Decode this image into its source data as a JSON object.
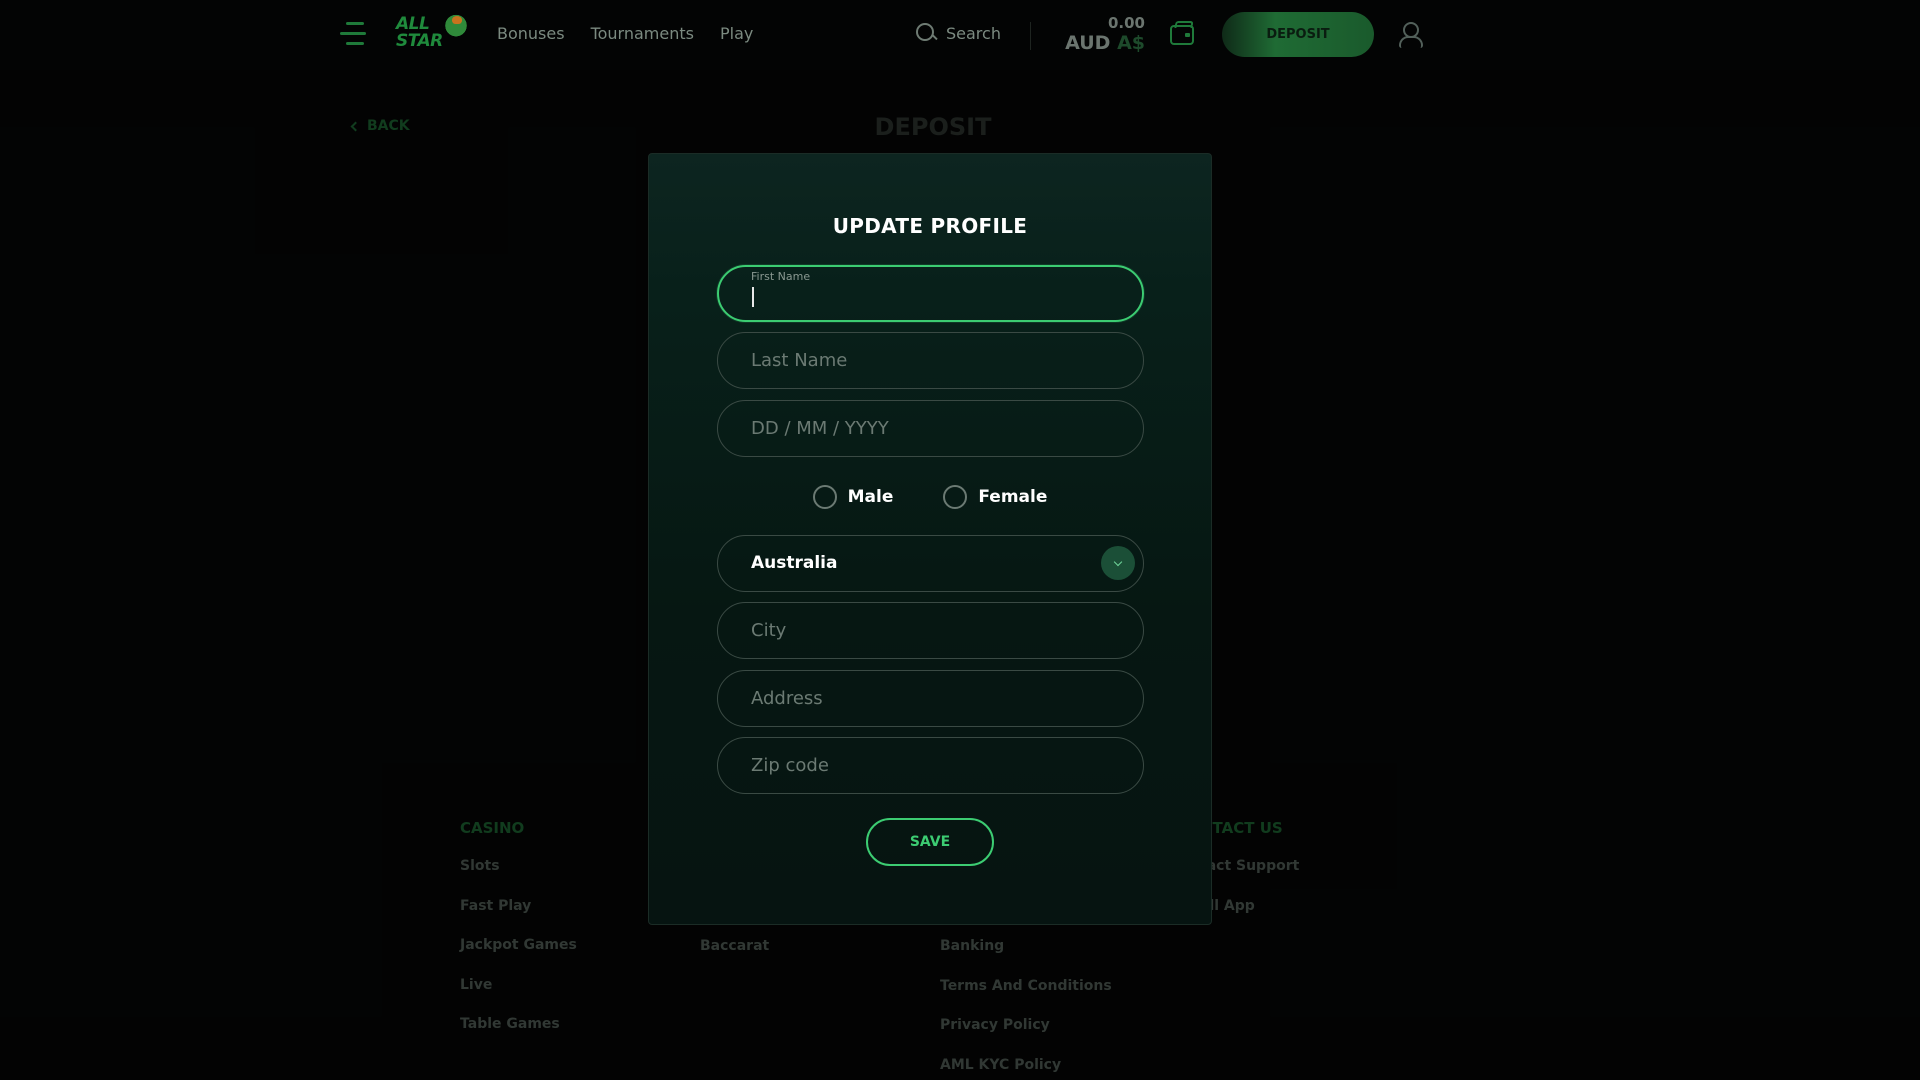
{
  "header": {
    "nav": [
      "Bonuses",
      "Tournaments",
      "Play"
    ],
    "search_label": "Search",
    "balance_amount": "0.00",
    "balance_currency": "AUD",
    "balance_symbol": "A$",
    "deposit_label": "DEPOSIT",
    "logo_text_line1": "ALL",
    "logo_text_line2": "STAR"
  },
  "page": {
    "back_label": "BACK",
    "title": "DEPOSIT"
  },
  "footer": {
    "casino_heading": "CASINO",
    "casino_items": [
      "Slots",
      "Fast Play",
      "Jackpot Games",
      "Live",
      "Table Games"
    ],
    "col2_items": [
      "Baccarat"
    ],
    "col3_items": [
      "Banking",
      "Terms And Conditions",
      "Privacy Policy",
      "AML KYC Policy"
    ],
    "contact_heading": "NTACT US",
    "contact_items": [
      "tact Support",
      "all App"
    ]
  },
  "modal": {
    "title": "UPDATE PROFILE",
    "first_name_label": "First Name",
    "last_name_placeholder": "Last Name",
    "dob_placeholder": "DD / MM / YYYY",
    "gender_male": "Male",
    "gender_female": "Female",
    "country_value": "Australia",
    "city_placeholder": "City",
    "address_placeholder": "Address",
    "zip_placeholder": "Zip code",
    "save_label": "SAVE"
  },
  "colors": {
    "accent": "#3ccc72",
    "brand_green": "#1f7a3a",
    "background": "#050606"
  }
}
